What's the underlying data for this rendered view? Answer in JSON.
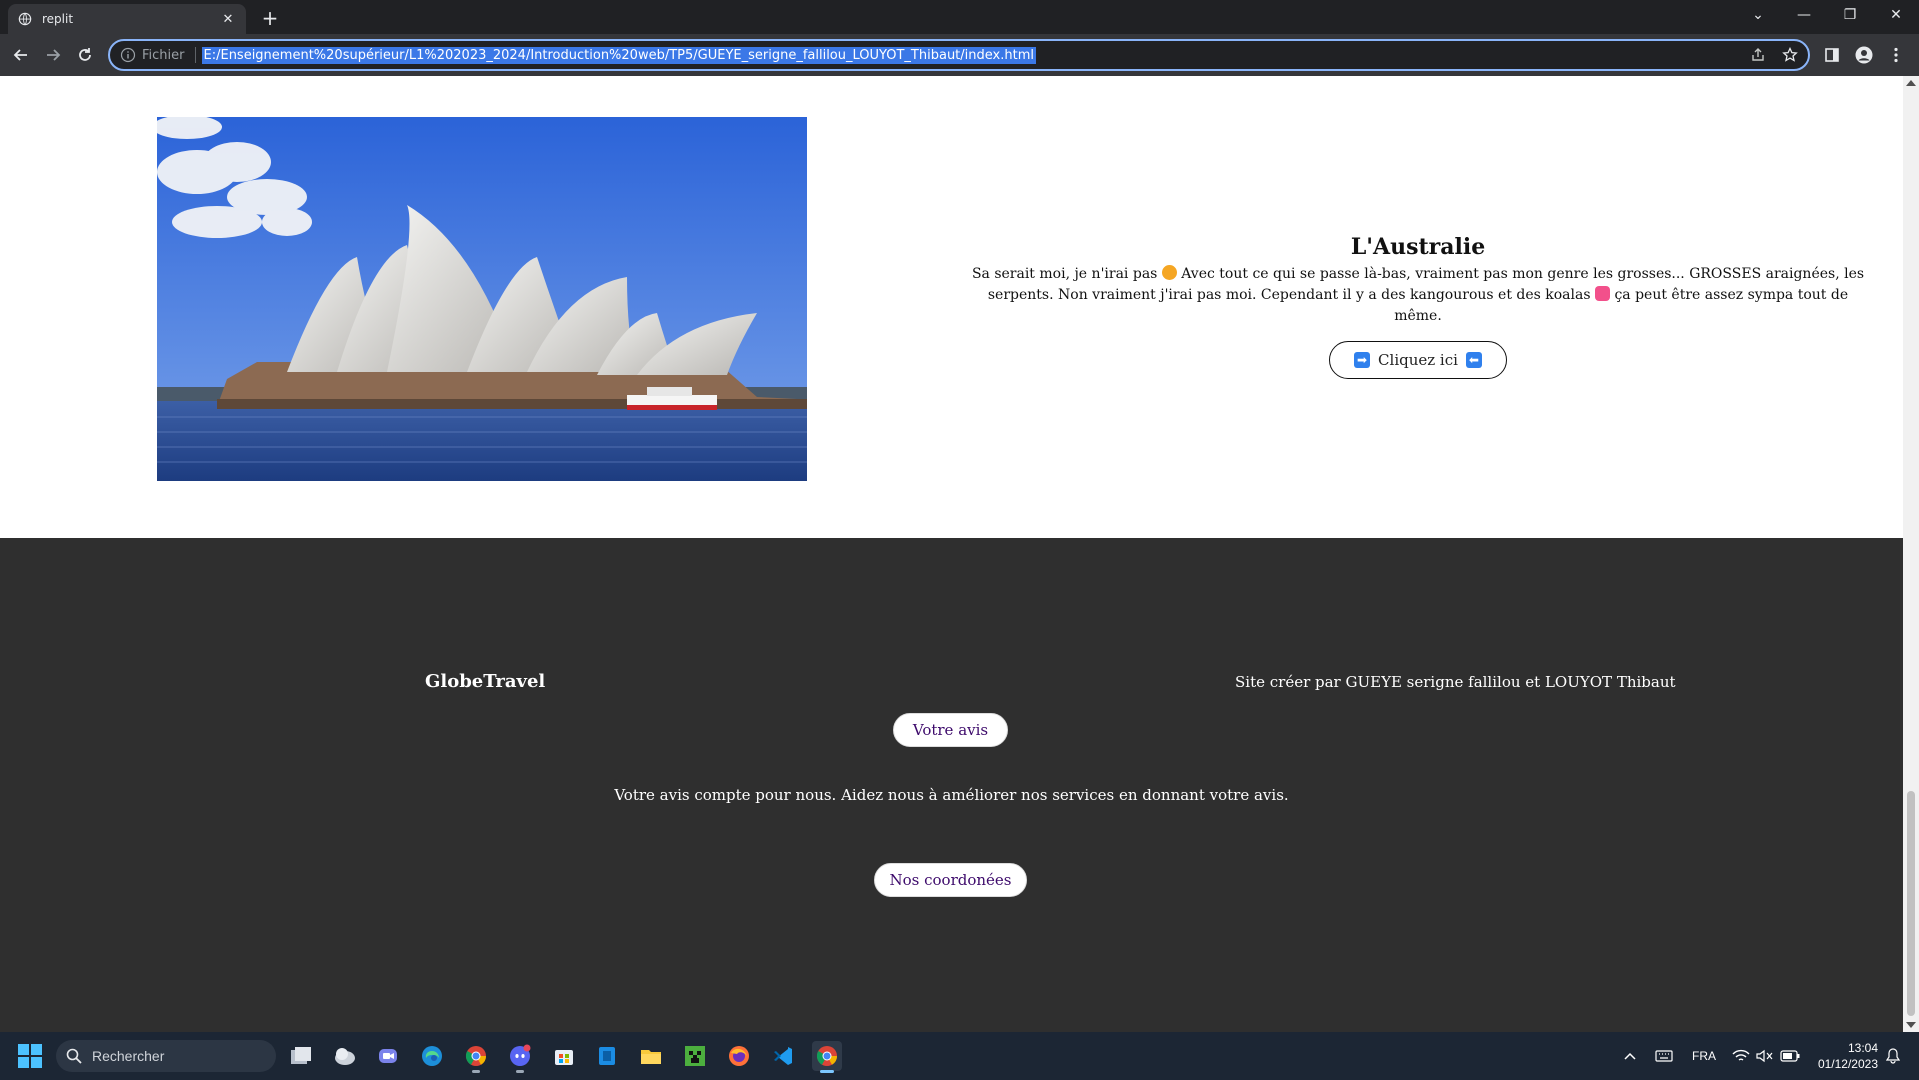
{
  "browser": {
    "tab_title": "replit",
    "omnibox_scheme": "Fichier",
    "url": "E:/Enseignement%20supérieur/L1%202023_2024/Introduction%20web/TP5/GUEYE_serigne_fallilou_LOUYOT_Thibaut/index.html"
  },
  "page": {
    "destination": {
      "title": "L'Australie",
      "text_before_emoji1": "Sa serait moi, je n'irai pas",
      "text_after_emoji1": "Avec tout ce qui se passe là-bas, vraiment pas mon genre les grosses... GROSSES araignées, les serpents. Non vraiment j'irai pas moi. Cependant il y a des kangourous et des koalas",
      "text_after_emoji2": "ça peut être assez sympa tout de même.",
      "button_label": "Cliquez ici"
    },
    "footer": {
      "brand": "GlobeTravel",
      "credits": "Site créer par GUEYE serigne fallilou et LOUYOT Thibaut",
      "feedback_button": "Votre avis",
      "feedback_text": "Votre avis compte pour nous. Aidez nous à améliorer nos services en donnant votre avis.",
      "contact_button": "Nos coordonées"
    }
  },
  "taskbar": {
    "search_placeholder": "Rechercher",
    "language": "FRA",
    "time": "13:04",
    "date": "01/12/2023"
  },
  "colors": {
    "footer_bg": "#2f2f2f",
    "omnibox_focus": "#8ab4f8",
    "button_text": "#3d0a6b"
  }
}
